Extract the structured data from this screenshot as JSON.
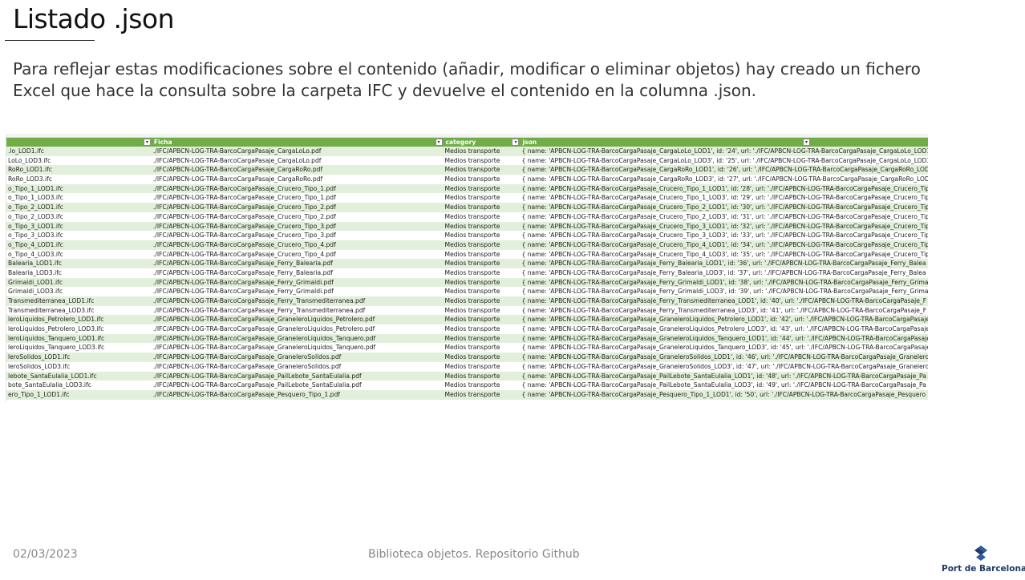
{
  "slide": {
    "title": "Listado .json",
    "body_lines": [
      "Para reflejar estas modificaciones sobre el contenido (añadir, modificar o eliminar objetos) hay creado un fichero",
      "Excel que hace la consulta sobre la carpeta IFC y devuelve el contenido en la columna .json."
    ]
  },
  "sheet": {
    "columns": [
      "",
      "Ficha",
      "category",
      "json"
    ],
    "rows": [
      [
        ".lo_LOD1.ifc",
        "./IFC/APBCN-LOG-TRA-BarcoCargaPasaje_CargaLoLo.pdf",
        "Medios transporte",
        "{ name: 'APBCN-LOG-TRA-BarcoCargaPasaje_CargaLoLo_LOD1', id: '24', url: './IFC/APBCN-LOG-TRA-BarcoCargaPasaje_CargaLoLo_LOD1"
      ],
      [
        "LoLo_LOD3.ifc",
        "./IFC/APBCN-LOG-TRA-BarcoCargaPasaje_CargaLoLo.pdf",
        "Medios transporte",
        "{ name: 'APBCN-LOG-TRA-BarcoCargaPasaje_CargaLoLo_LOD3', id: '25', url: './IFC/APBCN-LOG-TRA-BarcoCargaPasaje_CargaLoLo_LOD3"
      ],
      [
        "RoRo_LOD1.ifc",
        "./IFC/APBCN-LOG-TRA-BarcoCargaPasaje_CargaRoRo.pdf",
        "Medios transporte",
        "{ name: 'APBCN-LOG-TRA-BarcoCargaPasaje_CargaRoRo_LOD1', id: '26', url: './IFC/APBCN-LOG-TRA-BarcoCargaPasaje_CargaRoRo_LOD"
      ],
      [
        "RoRo_LOD3.ifc",
        "./IFC/APBCN-LOG-TRA-BarcoCargaPasaje_CargaRoRo.pdf",
        "Medios transporte",
        "{ name: 'APBCN-LOG-TRA-BarcoCargaPasaje_CargaRoRo_LOD3', id: '27', url: './IFC/APBCN-LOG-TRA-BarcoCargaPasaje_CargaRoRo_LOD"
      ],
      [
        "o_Tipo_1_LOD1.ifc",
        "./IFC/APBCN-LOG-TRA-BarcoCargaPasaje_Crucero_Tipo_1.pdf",
        "Medios transporte",
        "{ name: 'APBCN-LOG-TRA-BarcoCargaPasaje_Crucero_Tipo_1_LOD1', id: '28', url: './IFC/APBCN-LOG-TRA-BarcoCargaPasaje_Crucero_Tip"
      ],
      [
        "o_Tipo_1_LOD3.ifc",
        "./IFC/APBCN-LOG-TRA-BarcoCargaPasaje_Crucero_Tipo_1.pdf",
        "Medios transporte",
        "{ name: 'APBCN-LOG-TRA-BarcoCargaPasaje_Crucero_Tipo_1_LOD3', id: '29', url: './IFC/APBCN-LOG-TRA-BarcoCargaPasaje_Crucero_Tip"
      ],
      [
        "o_Tipo_2_LOD1.ifc",
        "./IFC/APBCN-LOG-TRA-BarcoCargaPasaje_Crucero_Tipo_2.pdf",
        "Medios transporte",
        "{ name: 'APBCN-LOG-TRA-BarcoCargaPasaje_Crucero_Tipo_2_LOD1', id: '30', url: './IFC/APBCN-LOG-TRA-BarcoCargaPasaje_Crucero_Tip"
      ],
      [
        "o_Tipo_2_LOD3.ifc",
        "./IFC/APBCN-LOG-TRA-BarcoCargaPasaje_Crucero_Tipo_2.pdf",
        "Medios transporte",
        "{ name: 'APBCN-LOG-TRA-BarcoCargaPasaje_Crucero_Tipo_2_LOD3', id: '31', url: './IFC/APBCN-LOG-TRA-BarcoCargaPasaje_Crucero_Tip"
      ],
      [
        "o_Tipo_3_LOD1.ifc",
        "./IFC/APBCN-LOG-TRA-BarcoCargaPasaje_Crucero_Tipo_3.pdf",
        "Medios transporte",
        "{ name: 'APBCN-LOG-TRA-BarcoCargaPasaje_Crucero_Tipo_3_LOD1', id: '32', url: './IFC/APBCN-LOG-TRA-BarcoCargaPasaje_Crucero_Tip"
      ],
      [
        "o_Tipo_3_LOD3.ifc",
        "./IFC/APBCN-LOG-TRA-BarcoCargaPasaje_Crucero_Tipo_3.pdf",
        "Medios transporte",
        "{ name: 'APBCN-LOG-TRA-BarcoCargaPasaje_Crucero_Tipo_3_LOD3', id: '33', url: './IFC/APBCN-LOG-TRA-BarcoCargaPasaje_Crucero_Tip"
      ],
      [
        "o_Tipo_4_LOD1.ifc",
        "./IFC/APBCN-LOG-TRA-BarcoCargaPasaje_Crucero_Tipo_4.pdf",
        "Medios transporte",
        "{ name: 'APBCN-LOG-TRA-BarcoCargaPasaje_Crucero_Tipo_4_LOD1', id: '34', url: './IFC/APBCN-LOG-TRA-BarcoCargaPasaje_Crucero_Tip"
      ],
      [
        "o_Tipo_4_LOD3.ifc",
        "./IFC/APBCN-LOG-TRA-BarcoCargaPasaje_Crucero_Tipo_4.pdf",
        "Medios transporte",
        "{ name: 'APBCN-LOG-TRA-BarcoCargaPasaje_Crucero_Tipo_4_LOD3', id: '35', url: './IFC/APBCN-LOG-TRA-BarcoCargaPasaje_Crucero_Tip"
      ],
      [
        "Balearia_LOD1.ifc",
        "./IFC/APBCN-LOG-TRA-BarcoCargaPasaje_Ferry_Balearia.pdf",
        "Medios transporte",
        "{ name: 'APBCN-LOG-TRA-BarcoCargaPasaje_Ferry_Balearia_LOD1', id: '36', url: './IFC/APBCN-LOG-TRA-BarcoCargaPasaje_Ferry_Balea"
      ],
      [
        "Balearia_LOD3.ifc",
        "./IFC/APBCN-LOG-TRA-BarcoCargaPasaje_Ferry_Balearia.pdf",
        "Medios transporte",
        "{ name: 'APBCN-LOG-TRA-BarcoCargaPasaje_Ferry_Balearia_LOD3', id: '37', url: './IFC/APBCN-LOG-TRA-BarcoCargaPasaje_Ferry_Balea"
      ],
      [
        "Grimaldi_LOD1.ifc",
        "./IFC/APBCN-LOG-TRA-BarcoCargaPasaje_Ferry_Grimaldi.pdf",
        "Medios transporte",
        "{ name: 'APBCN-LOG-TRA-BarcoCargaPasaje_Ferry_Grimaldi_LOD1', id: '38', url: './IFC/APBCN-LOG-TRA-BarcoCargaPasaje_Ferry_Grima"
      ],
      [
        "Grimaldi_LOD3.ifc",
        "./IFC/APBCN-LOG-TRA-BarcoCargaPasaje_Ferry_Grimaldi.pdf",
        "Medios transporte",
        "{ name: 'APBCN-LOG-TRA-BarcoCargaPasaje_Ferry_Grimaldi_LOD3', id: '39', url: './IFC/APBCN-LOG-TRA-BarcoCargaPasaje_Ferry_Grima"
      ],
      [
        "Transmediterranea_LOD1.ifc",
        "./IFC/APBCN-LOG-TRA-BarcoCargaPasaje_Ferry_Transmediterranea.pdf",
        "Medios transporte",
        "{ name: 'APBCN-LOG-TRA-BarcoCargaPasaje_Ferry_Transmediterranea_LOD1', id: '40', url: './IFC/APBCN-LOG-TRA-BarcoCargaPasaje_F"
      ],
      [
        "Transmediterranea_LOD3.ifc",
        "./IFC/APBCN-LOG-TRA-BarcoCargaPasaje_Ferry_Transmediterranea.pdf",
        "Medios transporte",
        "{ name: 'APBCN-LOG-TRA-BarcoCargaPasaje_Ferry_Transmediterranea_LOD3', id: '41', url: './IFC/APBCN-LOG-TRA-BarcoCargaPasaje_F"
      ],
      [
        "leroLiquidos_Petrolero_LOD1.ifc",
        "./IFC/APBCN-LOG-TRA-BarcoCargaPasaje_GraneleroLiquidos_Petrolero.pdf",
        "Medios transporte",
        "{ name: 'APBCN-LOG-TRA-BarcoCargaPasaje_GraneleroLiquidos_Petrolero_LOD1', id: '42', url: './IFC/APBCN-LOG-TRA-BarcoCargaPasaje"
      ],
      [
        "leroLiquidos_Petrolero_LOD3.ifc",
        "./IFC/APBCN-LOG-TRA-BarcoCargaPasaje_GraneleroLiquidos_Petrolero.pdf",
        "Medios transporte",
        "{ name: 'APBCN-LOG-TRA-BarcoCargaPasaje_GraneleroLiquidos_Petrolero_LOD3', id: '43', url: './IFC/APBCN-LOG-TRA-BarcoCargaPasaje"
      ],
      [
        "leroLiquidos_Tanquero_LOD1.ifc",
        "./IFC/APBCN-LOG-TRA-BarcoCargaPasaje_GraneleroLiquidos_Tanquero.pdf",
        "Medios transporte",
        "{ name: 'APBCN-LOG-TRA-BarcoCargaPasaje_GraneleroLiquidos_Tanquero_LOD1', id: '44', url: './IFC/APBCN-LOG-TRA-BarcoCargaPasaje"
      ],
      [
        "leroLiquidos_Tanquero_LOD3.ifc",
        "./IFC/APBCN-LOG-TRA-BarcoCargaPasaje_GraneleroLiquidos_Tanquero.pdf",
        "Medios transporte",
        "{ name: 'APBCN-LOG-TRA-BarcoCargaPasaje_GraneleroLiquidos_Tanquero_LOD3', id: '45', url: './IFC/APBCN-LOG-TRA-BarcoCargaPasaje"
      ],
      [
        "leroSolidos_LOD1.ifc",
        "./IFC/APBCN-LOG-TRA-BarcoCargaPasaje_GraneleroSolidos.pdf",
        "Medios transporte",
        "{ name: 'APBCN-LOG-TRA-BarcoCargaPasaje_GraneleroSolidos_LOD1', id: '46', url: './IFC/APBCN-LOG-TRA-BarcoCargaPasaje_Granelero"
      ],
      [
        "leroSolidos_LOD3.ifc",
        "./IFC/APBCN-LOG-TRA-BarcoCargaPasaje_GraneleroSolidos.pdf",
        "Medios transporte",
        "{ name: 'APBCN-LOG-TRA-BarcoCargaPasaje_GraneleroSolidos_LOD3', id: '47', url: './IFC/APBCN-LOG-TRA-BarcoCargaPasaje_Granelero"
      ],
      [
        "lebote_SantaEulalia_LOD1.ifc",
        "./IFC/APBCN-LOG-TRA-BarcoCargaPasaje_PailLebote_SantaEulalia.pdf",
        "Medios transporte",
        "{ name: 'APBCN-LOG-TRA-BarcoCargaPasaje_PailLebote_SantaEulalia_LOD1', id: '48', url: './IFC/APBCN-LOG-TRA-BarcoCargaPasaje_Pa"
      ],
      [
        "bote_SantaEulalia_LOD3.ifc",
        "./IFC/APBCN-LOG-TRA-BarcoCargaPasaje_PailLebote_SantaEulalia.pdf",
        "Medios transporte",
        "{ name: 'APBCN-LOG-TRA-BarcoCargaPasaje_PailLebote_SantaEulalia_LOD3', id: '49', url: './IFC/APBCN-LOG-TRA-BarcoCargaPasaje_Pa"
      ],
      [
        "ero_Tipo_1_LOD1.ifc",
        "./IFC/APBCN-LOG-TRA-BarcoCargaPasaje_Pesquero_Tipo_1.pdf",
        "Medios transporte",
        "{ name: 'APBCN-LOG-TRA-BarcoCargaPasaje_Pesquero_Tipo_1_LOD1', id: '50', url: './IFC/APBCN-LOG-TRA-BarcoCargaPasaje_Pesquero"
      ]
    ]
  },
  "footer": {
    "date": "02/03/2023",
    "center": "Biblioteca objetos. Repositorio Github",
    "logo_text": "Port de Barcelona"
  },
  "colors": {
    "header_green": "#70ad47",
    "band_green": "#e2efda",
    "logo_blue": "#1f3a63"
  },
  "icons": [
    "filter-dropdown-icon",
    "port-de-barcelona-logo"
  ]
}
